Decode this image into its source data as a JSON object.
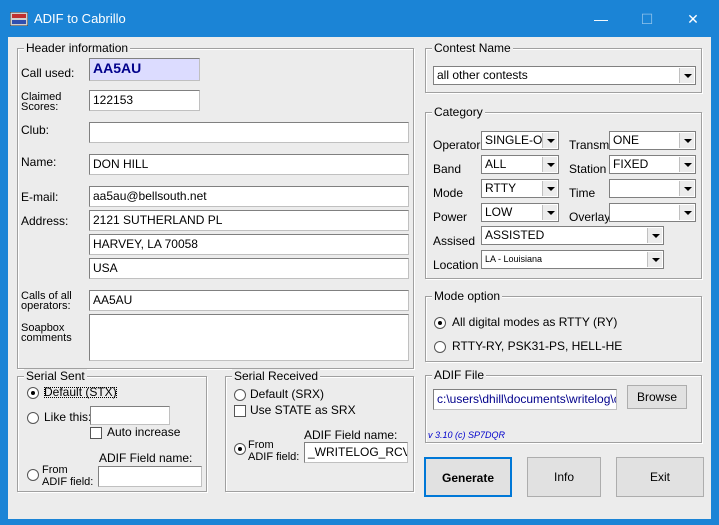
{
  "window": {
    "title": "ADIF to Cabrillo",
    "minimize": "—",
    "maximize": "☐",
    "close": "✕"
  },
  "header": {
    "group_label": "Header information",
    "call_used_label": "Call used:",
    "call_used": "AA5AU",
    "claimed_label": "Claimed Scores:",
    "claimed": "122153",
    "club_label": "Club:",
    "club": "",
    "name_label": "Name:",
    "name": "DON HILL",
    "email_label": "E-mail:",
    "email": "aa5au@bellsouth.net",
    "address_label": "Address:",
    "address1": "2121 SUTHERLAND PL",
    "address2": "HARVEY, LA 70058",
    "address3": "USA",
    "operators_label": "Calls of all operators:",
    "operators": "AA5AU",
    "soapbox_label": "Soapbox comments",
    "soapbox": ""
  },
  "contest": {
    "group_label": "Contest Name",
    "value": "all other contests"
  },
  "category": {
    "group_label": "Category",
    "operator_label": "Operator",
    "operator": "SINGLE-OP",
    "band_label": "Band",
    "band": "ALL",
    "mode_label": "Mode",
    "mode": "RTTY",
    "power_label": "Power",
    "power": "LOW",
    "transm_label": "Transm.",
    "transm": "ONE",
    "station_label": "Station",
    "station": "FIXED",
    "time_label": "Time",
    "time": "",
    "overlay_label": "Overlay",
    "overlay": "",
    "assisted_label": "Assised",
    "assisted": "ASSISTED",
    "location_label": "Location",
    "location": "LA  - Louisiana"
  },
  "mode_option": {
    "group_label": "Mode option",
    "opt1": "All digital modes as RTTY (RY)",
    "opt2": "RTTY-RY, PSK31-PS, HELL-HE"
  },
  "adif_file": {
    "group_label": "ADIF File",
    "path": "c:\\users\\dhill\\documents\\writelog\\con",
    "browse": "Browse",
    "version": "v 3.10  (c) SP7DQR"
  },
  "serial_sent": {
    "group_label": "Serial Sent",
    "default": "Default (STX)",
    "like_this": "Like this:",
    "auto_inc": "Auto increase",
    "from_adif": "From ADIF field:",
    "adif_field_label": "ADIF Field name:",
    "adif_field": ""
  },
  "serial_received": {
    "group_label": "Serial Received",
    "default": "Default (SRX)",
    "use_state": "Use STATE as SRX",
    "from_adif": "From ADIF field:",
    "adif_field_label": "ADIF Field name:",
    "adif_field": "_WRITELOG_RCVD"
  },
  "buttons": {
    "generate": "Generate",
    "info": "Info",
    "exit": "Exit"
  }
}
